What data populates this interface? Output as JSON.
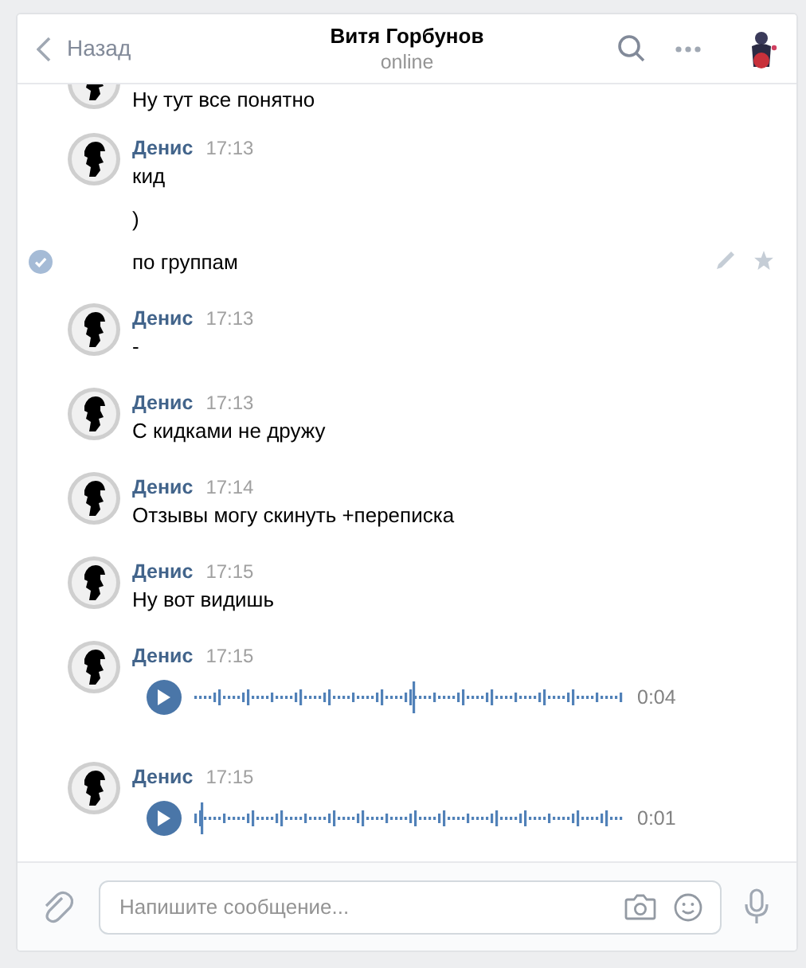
{
  "header": {
    "back": "Назад",
    "title": "Витя Горбунов",
    "status": "online"
  },
  "groups": [
    {
      "items": [
        {
          "kind": "text",
          "text": "Ну тут все понятно",
          "selected": false
        }
      ]
    },
    {
      "author": "Денис",
      "time": "17:13",
      "items": [
        {
          "kind": "text",
          "text": "кид",
          "selected": false
        },
        {
          "kind": "text",
          "text": ")",
          "selected": false
        },
        {
          "kind": "text",
          "text": "по группам",
          "selected": true
        }
      ]
    },
    {
      "author": "Денис",
      "time": "17:13",
      "items": [
        {
          "kind": "text",
          "text": "-",
          "selected": false
        }
      ]
    },
    {
      "author": "Денис",
      "time": "17:13",
      "items": [
        {
          "kind": "text",
          "text": "С кидками не дружу",
          "selected": false
        }
      ]
    },
    {
      "author": "Денис",
      "time": "17:14",
      "items": [
        {
          "kind": "text",
          "text": "Отзывы могу скинуть +переписка",
          "selected": false
        }
      ]
    },
    {
      "author": "Денис",
      "time": "17:15",
      "items": [
        {
          "kind": "text",
          "text": "Ну вот видишь",
          "selected": false
        }
      ]
    },
    {
      "author": "Денис",
      "time": "17:15",
      "items": [
        {
          "kind": "voice",
          "duration": "0:04",
          "selected": false
        }
      ]
    },
    {
      "author": "Денис",
      "time": "17:15",
      "items": [
        {
          "kind": "voice",
          "duration": "0:01",
          "selected": false
        }
      ]
    }
  ],
  "composer": {
    "placeholder": "Напишите сообщение..."
  }
}
